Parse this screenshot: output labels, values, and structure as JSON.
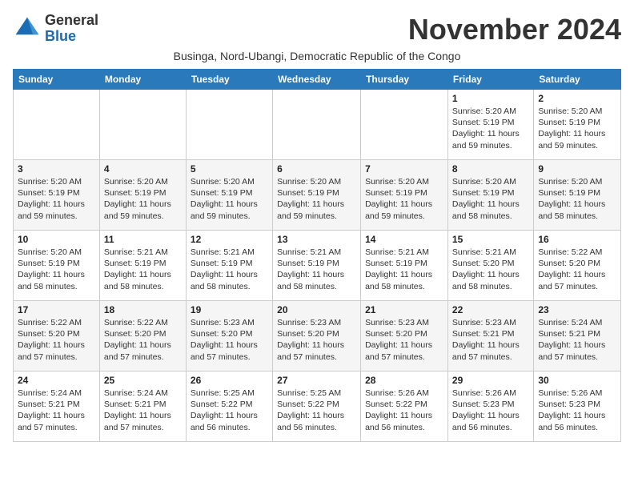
{
  "header": {
    "logo_line1": "General",
    "logo_line2": "Blue",
    "month_title": "November 2024",
    "subtitle": "Businga, Nord-Ubangi, Democratic Republic of the Congo"
  },
  "weekdays": [
    "Sunday",
    "Monday",
    "Tuesday",
    "Wednesday",
    "Thursday",
    "Friday",
    "Saturday"
  ],
  "weeks": [
    [
      {
        "day": "",
        "info": ""
      },
      {
        "day": "",
        "info": ""
      },
      {
        "day": "",
        "info": ""
      },
      {
        "day": "",
        "info": ""
      },
      {
        "day": "",
        "info": ""
      },
      {
        "day": "1",
        "info": "Sunrise: 5:20 AM\nSunset: 5:19 PM\nDaylight: 11 hours and 59 minutes."
      },
      {
        "day": "2",
        "info": "Sunrise: 5:20 AM\nSunset: 5:19 PM\nDaylight: 11 hours and 59 minutes."
      }
    ],
    [
      {
        "day": "3",
        "info": "Sunrise: 5:20 AM\nSunset: 5:19 PM\nDaylight: 11 hours and 59 minutes."
      },
      {
        "day": "4",
        "info": "Sunrise: 5:20 AM\nSunset: 5:19 PM\nDaylight: 11 hours and 59 minutes."
      },
      {
        "day": "5",
        "info": "Sunrise: 5:20 AM\nSunset: 5:19 PM\nDaylight: 11 hours and 59 minutes."
      },
      {
        "day": "6",
        "info": "Sunrise: 5:20 AM\nSunset: 5:19 PM\nDaylight: 11 hours and 59 minutes."
      },
      {
        "day": "7",
        "info": "Sunrise: 5:20 AM\nSunset: 5:19 PM\nDaylight: 11 hours and 59 minutes."
      },
      {
        "day": "8",
        "info": "Sunrise: 5:20 AM\nSunset: 5:19 PM\nDaylight: 11 hours and 58 minutes."
      },
      {
        "day": "9",
        "info": "Sunrise: 5:20 AM\nSunset: 5:19 PM\nDaylight: 11 hours and 58 minutes."
      }
    ],
    [
      {
        "day": "10",
        "info": "Sunrise: 5:20 AM\nSunset: 5:19 PM\nDaylight: 11 hours and 58 minutes."
      },
      {
        "day": "11",
        "info": "Sunrise: 5:21 AM\nSunset: 5:19 PM\nDaylight: 11 hours and 58 minutes."
      },
      {
        "day": "12",
        "info": "Sunrise: 5:21 AM\nSunset: 5:19 PM\nDaylight: 11 hours and 58 minutes."
      },
      {
        "day": "13",
        "info": "Sunrise: 5:21 AM\nSunset: 5:19 PM\nDaylight: 11 hours and 58 minutes."
      },
      {
        "day": "14",
        "info": "Sunrise: 5:21 AM\nSunset: 5:19 PM\nDaylight: 11 hours and 58 minutes."
      },
      {
        "day": "15",
        "info": "Sunrise: 5:21 AM\nSunset: 5:20 PM\nDaylight: 11 hours and 58 minutes."
      },
      {
        "day": "16",
        "info": "Sunrise: 5:22 AM\nSunset: 5:20 PM\nDaylight: 11 hours and 57 minutes."
      }
    ],
    [
      {
        "day": "17",
        "info": "Sunrise: 5:22 AM\nSunset: 5:20 PM\nDaylight: 11 hours and 57 minutes."
      },
      {
        "day": "18",
        "info": "Sunrise: 5:22 AM\nSunset: 5:20 PM\nDaylight: 11 hours and 57 minutes."
      },
      {
        "day": "19",
        "info": "Sunrise: 5:23 AM\nSunset: 5:20 PM\nDaylight: 11 hours and 57 minutes."
      },
      {
        "day": "20",
        "info": "Sunrise: 5:23 AM\nSunset: 5:20 PM\nDaylight: 11 hours and 57 minutes."
      },
      {
        "day": "21",
        "info": "Sunrise: 5:23 AM\nSunset: 5:20 PM\nDaylight: 11 hours and 57 minutes."
      },
      {
        "day": "22",
        "info": "Sunrise: 5:23 AM\nSunset: 5:21 PM\nDaylight: 11 hours and 57 minutes."
      },
      {
        "day": "23",
        "info": "Sunrise: 5:24 AM\nSunset: 5:21 PM\nDaylight: 11 hours and 57 minutes."
      }
    ],
    [
      {
        "day": "24",
        "info": "Sunrise: 5:24 AM\nSunset: 5:21 PM\nDaylight: 11 hours and 57 minutes."
      },
      {
        "day": "25",
        "info": "Sunrise: 5:24 AM\nSunset: 5:21 PM\nDaylight: 11 hours and 57 minutes."
      },
      {
        "day": "26",
        "info": "Sunrise: 5:25 AM\nSunset: 5:22 PM\nDaylight: 11 hours and 56 minutes."
      },
      {
        "day": "27",
        "info": "Sunrise: 5:25 AM\nSunset: 5:22 PM\nDaylight: 11 hours and 56 minutes."
      },
      {
        "day": "28",
        "info": "Sunrise: 5:26 AM\nSunset: 5:22 PM\nDaylight: 11 hours and 56 minutes."
      },
      {
        "day": "29",
        "info": "Sunrise: 5:26 AM\nSunset: 5:23 PM\nDaylight: 11 hours and 56 minutes."
      },
      {
        "day": "30",
        "info": "Sunrise: 5:26 AM\nSunset: 5:23 PM\nDaylight: 11 hours and 56 minutes."
      }
    ]
  ]
}
